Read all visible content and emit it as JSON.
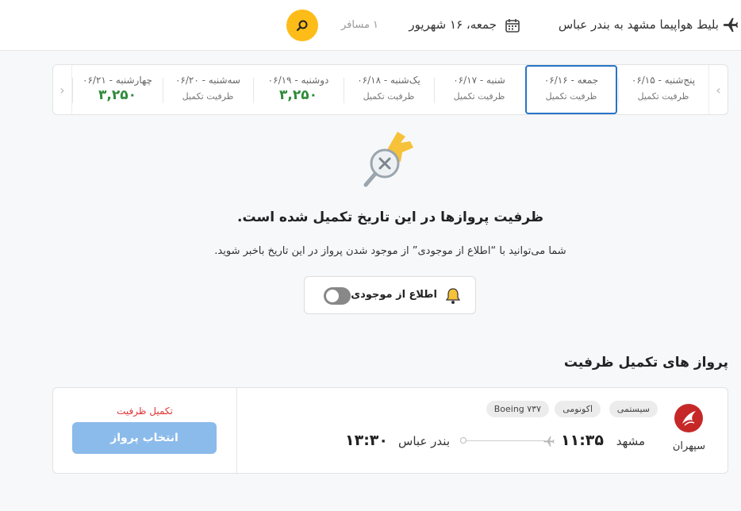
{
  "header": {
    "route_title": "بلیط هواپیما مشهد به بندر عباس",
    "date": "جمعه، ۱۶ شهریور",
    "passengers": "۱ مسافر",
    "icons": {
      "plane": "airplane-icon",
      "calendar": "calendar-icon",
      "search": "search-icon"
    },
    "accent_color": "#fdbc17"
  },
  "date_strip": {
    "prev_arrow": "‹",
    "next_arrow": "›",
    "days": [
      {
        "label": "پنج‌شنبه - ۰۶/۱۵",
        "status": "ظرفیت تکمیل",
        "price": ""
      },
      {
        "label": "جمعه - ۰۶/۱۶",
        "status": "ظرفیت تکمیل",
        "price": "",
        "selected": true
      },
      {
        "label": "شنبه - ۰۶/۱۷",
        "status": "ظرفیت تکمیل",
        "price": ""
      },
      {
        "label": "یک‌شنبه - ۰۶/۱۸",
        "status": "ظرفیت تکمیل",
        "price": ""
      },
      {
        "label": "دوشنبه - ۰۶/۱۹",
        "status": "",
        "price": "۳,۲۵۰"
      },
      {
        "label": "سه‌شنبه - ۰۶/۲۰",
        "status": "ظرفیت تکمیل",
        "price": ""
      },
      {
        "label": "چهارشنبه - ۰۶/۲۱",
        "status": "",
        "price": "۳,۲۵۰"
      }
    ],
    "selected_border_color": "#2874c7",
    "price_color": "#2e8b3a"
  },
  "empty_state": {
    "title": "ظرفیت پروازها در این تاریخ تکمیل شده است.",
    "subtitle": "شما می‌توانید با “اطلاع از موجودی” از موجود شدن پرواز در این تاریخ باخبر شوید.",
    "notify_label": "اطلاع از موجودی",
    "toggle_on": false
  },
  "full_flights": {
    "section_title": "پرواز های تکمیل ظرفیت",
    "flights": [
      {
        "airline": "سپهران",
        "tags": [
          "سیستمی",
          "اکونومی",
          "Boeing ۷۳۷"
        ],
        "origin": "مشهد",
        "departure_time": "۱۱:۳۵",
        "destination": "بندر عباس",
        "arrival_time": "۱۳:۳۰",
        "status": "تکمیل ظرفیت",
        "select_label": "انتخاب پرواز"
      }
    ]
  }
}
